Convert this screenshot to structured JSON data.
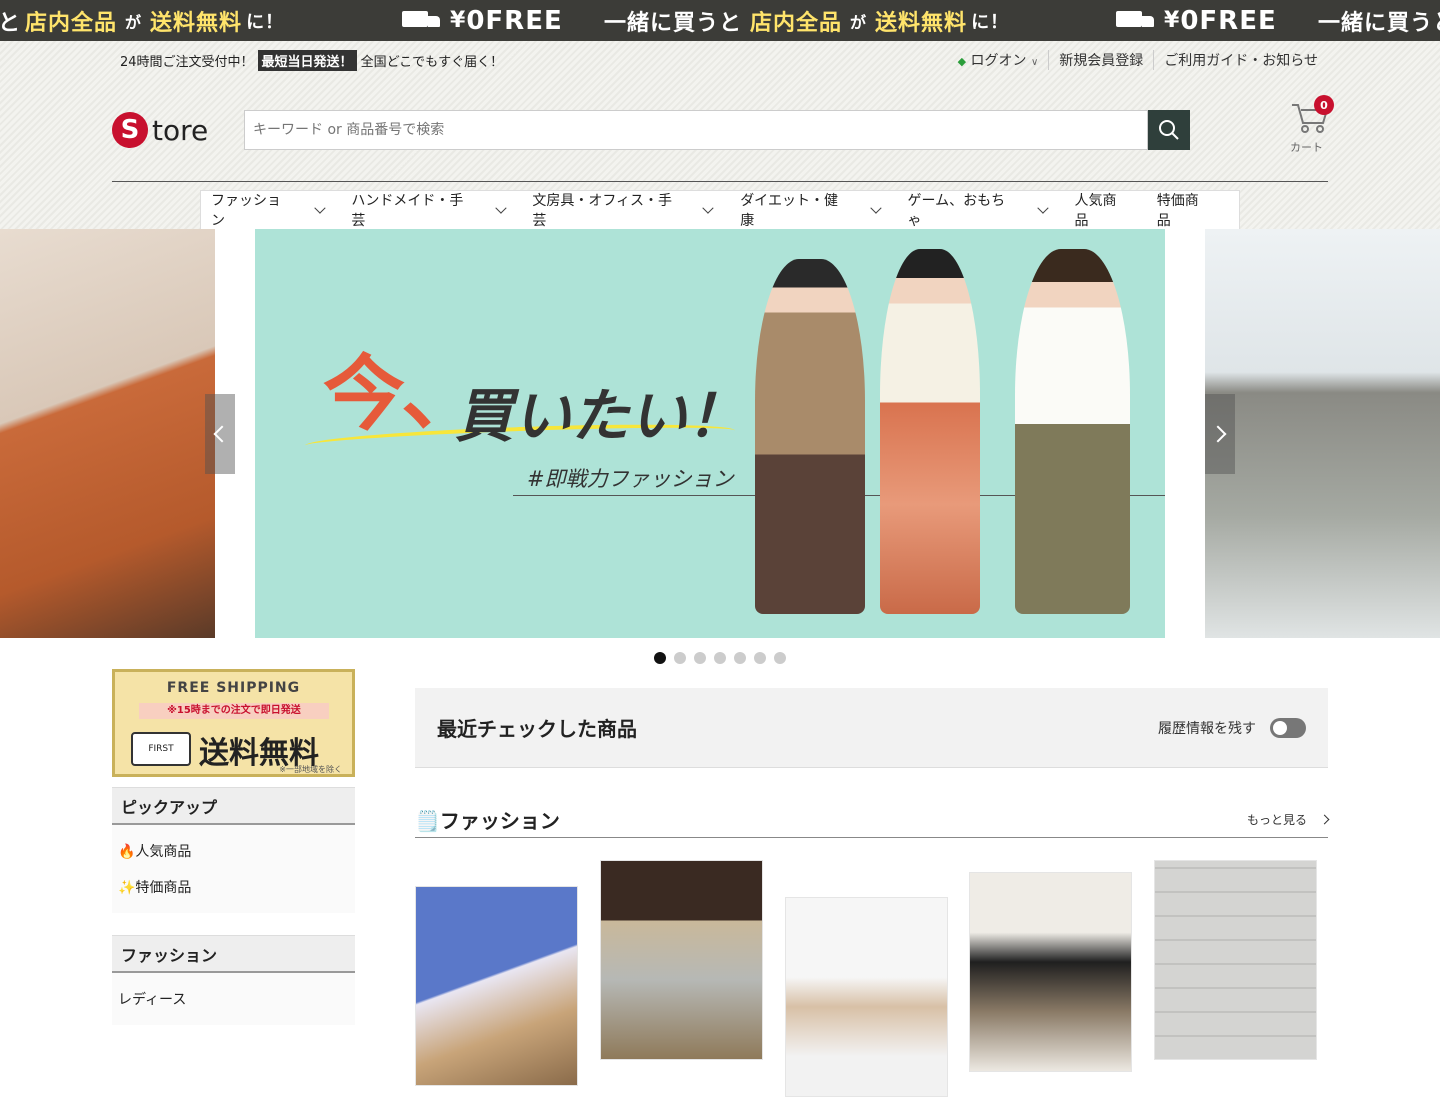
{
  "marquee": {
    "segments": [
      {
        "pre": "と",
        "highlight": "店内全品",
        "mid": "が",
        "highlight2": "送料無料",
        "post": "に！"
      },
      {
        "yen": "¥",
        "zero": "0",
        "free": "FREE"
      },
      {
        "pre": "一緒に買うと",
        "highlight": "店内全品",
        "mid": "が",
        "highlight2": "送料無料",
        "post": "に！"
      },
      {
        "yen": "¥",
        "zero": "0",
        "free": "FREE"
      },
      {
        "pre": "一緒に買うと"
      }
    ]
  },
  "topbar": {
    "text1": "24時間ご注文受付中！",
    "highlight": "最短当日発送！",
    "text2": "全国どこでもすぐ届く！"
  },
  "toplinks": {
    "login": "ログオン",
    "register": "新規会員登録",
    "guide": "ご利用ガイド・お知らせ"
  },
  "logo": {
    "mark": "S",
    "text": "tore"
  },
  "search": {
    "placeholder": "キーワード or 商品番号で検索"
  },
  "cart": {
    "label": "カート",
    "count": "0"
  },
  "nav": [
    {
      "label": "ファッション",
      "chevron": true
    },
    {
      "label": "ハンドメイド・手芸",
      "chevron": true
    },
    {
      "label": "文房具・オフィス・手芸",
      "chevron": true
    },
    {
      "label": "ダイエット・健康",
      "chevron": true
    },
    {
      "label": "ゲーム、おもちゃ",
      "chevron": true
    },
    {
      "label": "人気商品",
      "chevron": false
    },
    {
      "label": "特価商品",
      "chevron": false
    }
  ],
  "hero": {
    "big": "今、",
    "mid": "買いたい！",
    "tag": "#即戦力ファッション",
    "slides": 7,
    "active": 0
  },
  "shipping": {
    "l1": "FREE SHIPPING",
    "l2": "※15時までの注文で即日発送",
    "truck": "FIRST",
    "l3": "送料無料",
    "l4": "※一部地域を除く"
  },
  "pickup": {
    "title": "ピックアップ",
    "items": [
      "🔥人気商品",
      "✨特価商品"
    ]
  },
  "fashionSide": {
    "title": "ファッション",
    "items": [
      "レディース"
    ]
  },
  "recent": {
    "title": "最近チェックした商品",
    "history": "履歴情報を残す"
  },
  "fashionSection": {
    "title": "🗒️ファッション",
    "more": "もっと見る"
  },
  "colors": {
    "accent": "#c8102e",
    "dark": "#2f3f3b",
    "banner": "#aee3d7"
  }
}
